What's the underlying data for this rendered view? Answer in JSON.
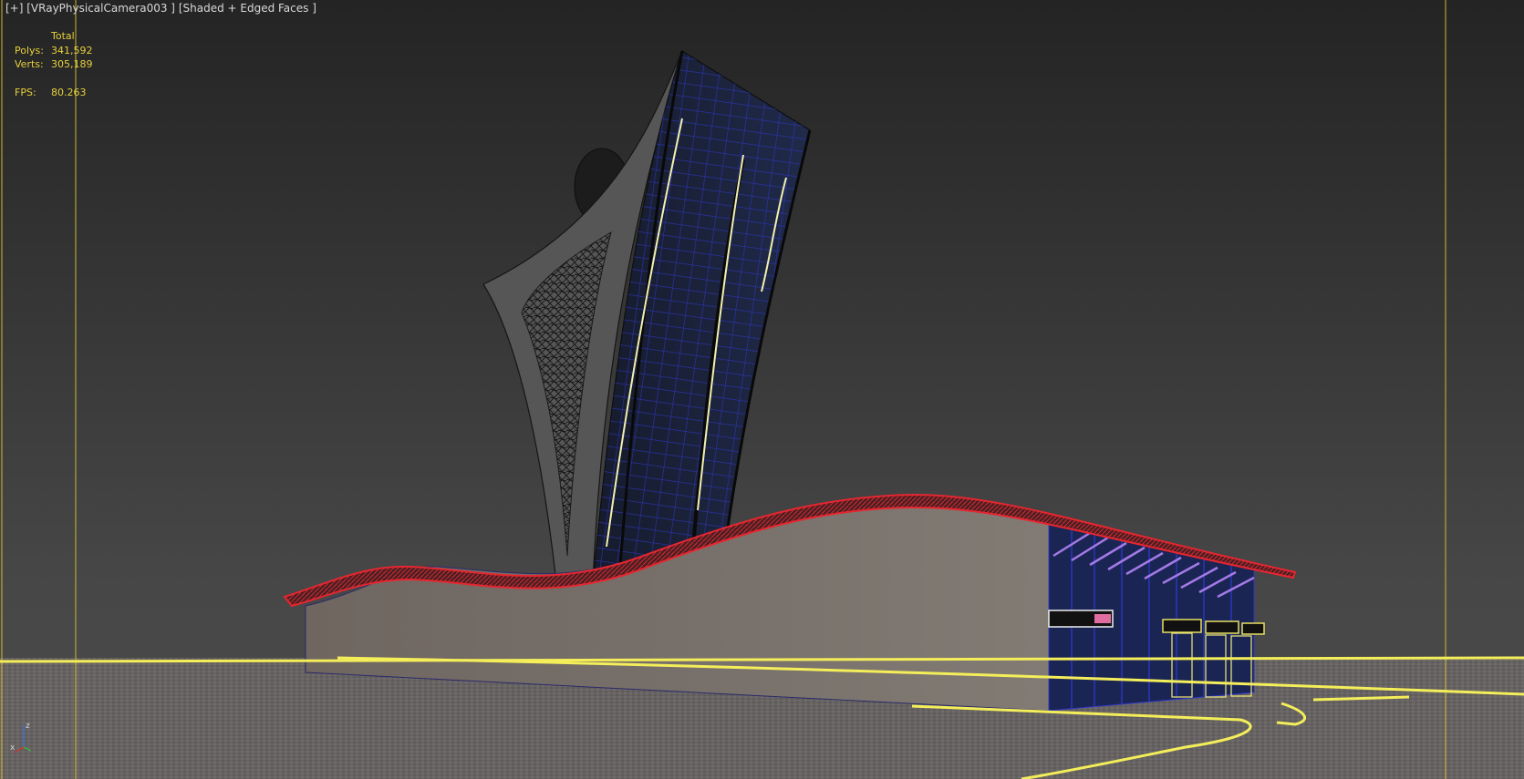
{
  "viewport": {
    "menu_plus": "[+]",
    "camera": "[VRayPhysicalCamera003 ]",
    "shading": "[Shaded + Edged Faces ]"
  },
  "stats": {
    "header": "Total",
    "polys_label": "Polys:",
    "polys_value": "341,592",
    "verts_label": "Verts:",
    "verts_value": "305,189",
    "fps_label": "FPS:",
    "fps_value": "80.263"
  },
  "axis": {
    "z_label": "z",
    "x_label": "x"
  },
  "colors": {
    "background": "#3c3c3c",
    "safe_frame": "#d8c338",
    "horizon_line": "#f4ee5a",
    "roof_edge": "#e52630",
    "glass_blue": "#2a32b8",
    "wall": "#6f6862",
    "ground": "#6a6664"
  }
}
